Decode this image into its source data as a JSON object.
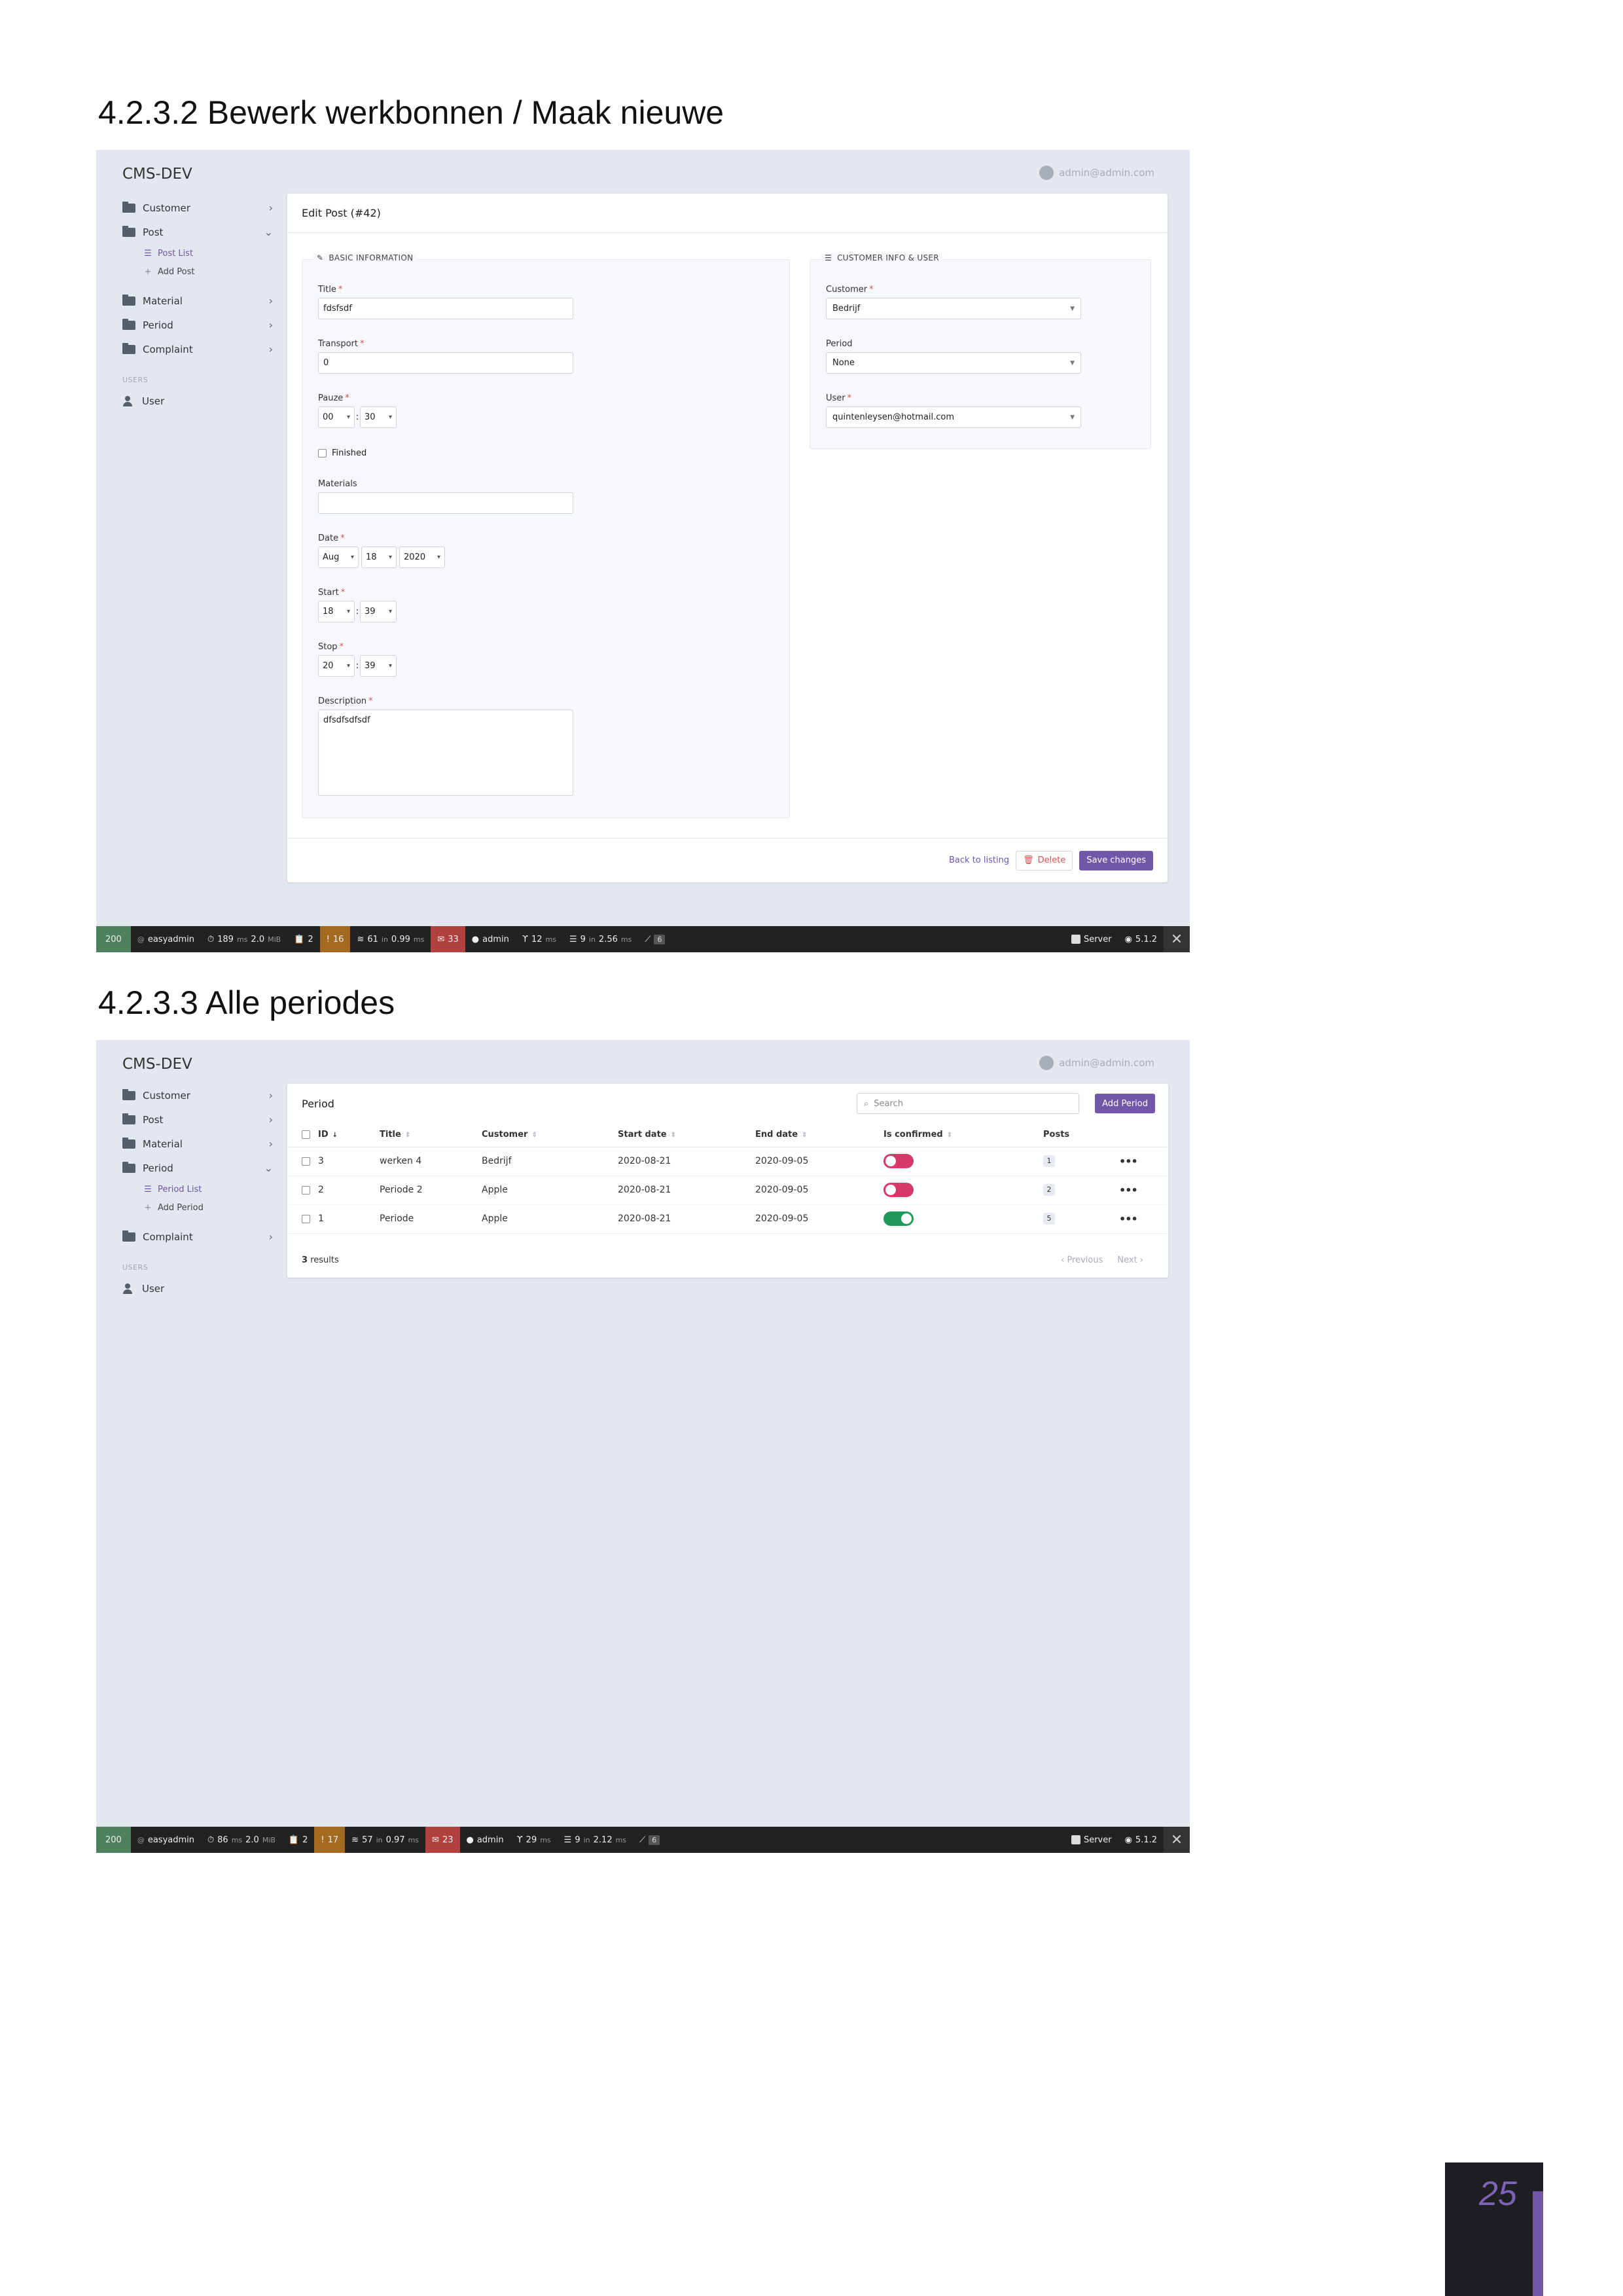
{
  "headings": {
    "section1": "4.2.3.2 Bewerk werkbonnen / Maak nieuwe",
    "section2": "4.2.3.3 Alle periodes"
  },
  "app": {
    "brand": "CMS-DEV",
    "account": "admin@admin.com"
  },
  "shot1": {
    "nav": {
      "customer": "Customer",
      "post": "Post",
      "post_list": "Post List",
      "add_post": "Add Post",
      "material": "Material",
      "period": "Period",
      "complaint": "Complaint",
      "users_section": "USERS",
      "user": "User"
    },
    "card_title": "Edit Post (#42)",
    "basic_legend": "BASIC INFORMATION",
    "customer_legend": "CUSTOMER INFO & USER",
    "fields": {
      "title_label": "Title",
      "title_value": "fdsfsdf",
      "transport_label": "Transport",
      "transport_value": "0",
      "pauze_label": "Pauze",
      "pauze_h": "00",
      "pauze_m": "30",
      "finished_label": "Finished",
      "materials_label": "Materials",
      "materials_value": "",
      "date_label": "Date",
      "date_month": "Aug",
      "date_day": "18",
      "date_year": "2020",
      "start_label": "Start",
      "start_h": "18",
      "start_m": "39",
      "stop_label": "Stop",
      "stop_h": "20",
      "stop_m": "39",
      "description_label": "Description",
      "description_value": "dfsdfsdfsdf",
      "customer_label": "Customer",
      "customer_value": "Bedrijf",
      "period_label": "Period",
      "period_value": "None",
      "user_label": "User",
      "user_value": "quintenleysen@hotmail.com",
      "colon": ":",
      "required_mark": "*"
    },
    "actions": {
      "back": "Back to listing",
      "delete": "Delete",
      "save": "Save changes"
    },
    "toolbar": {
      "status": "200",
      "route": "easyadmin",
      "time": "189",
      "time_unit": "ms",
      "memory": "2.0",
      "memory_unit": "MiB",
      "forms": "2",
      "warnings": "16",
      "cache": "61",
      "cache_in": "in",
      "cache_time": "0.99",
      "cache_unit": "ms",
      "logs": "33",
      "user": "admin",
      "twig": "12",
      "twig_unit": "ms",
      "db": "9",
      "db_in": "in",
      "db_time": "2.56",
      "db_unit": "ms",
      "tools": "6",
      "server": "Server",
      "version": "5.1.2"
    }
  },
  "shot2": {
    "nav": {
      "customer": "Customer",
      "post": "Post",
      "material": "Material",
      "period": "Period",
      "period_list": "Period List",
      "add_period": "Add Period",
      "complaint": "Complaint",
      "users_section": "USERS",
      "user": "User"
    },
    "card_title": "Period",
    "search_placeholder": "Search",
    "add_button": "Add Period",
    "columns": {
      "id": "ID",
      "title": "Title",
      "customer": "Customer",
      "start": "Start date",
      "end": "End date",
      "confirmed": "Is confirmed",
      "posts": "Posts"
    },
    "rows": [
      {
        "id": "3",
        "title": "werken 4",
        "customer": "Bedrijf",
        "start": "2020-08-21",
        "end": "2020-09-05",
        "confirmed": false,
        "posts": "1",
        "more": "•••"
      },
      {
        "id": "2",
        "title": "Periode 2",
        "customer": "Apple",
        "start": "2020-08-21",
        "end": "2020-09-05",
        "confirmed": false,
        "posts": "2",
        "more": "•••"
      },
      {
        "id": "1",
        "title": "Periode",
        "customer": "Apple",
        "start": "2020-08-21",
        "end": "2020-09-05",
        "confirmed": true,
        "posts": "5",
        "more": "•••"
      }
    ],
    "results_count": "3",
    "results_label": "results",
    "previous": "‹ Previous",
    "next": "Next ›",
    "toolbar": {
      "status": "200",
      "route": "easyadmin",
      "time": "86",
      "time_unit": "ms",
      "memory": "2.0",
      "memory_unit": "MiB",
      "forms": "2",
      "warnings": "17",
      "cache": "57",
      "cache_in": "in",
      "cache_time": "0.97",
      "cache_unit": "ms",
      "logs": "23",
      "user": "admin",
      "twig": "29",
      "twig_unit": "ms",
      "db": "9",
      "db_in": "in",
      "db_time": "2.12",
      "db_unit": "ms",
      "tools": "6",
      "server": "Server",
      "version": "5.1.2"
    }
  },
  "page_number": "25",
  "colors": {
    "accent": "#7157a8",
    "toggle_off": "#d63867",
    "toggle_on": "#1f9a5a",
    "status_ok": "#4f805d"
  }
}
